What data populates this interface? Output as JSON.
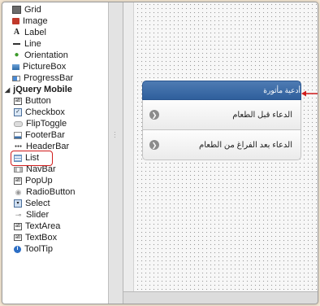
{
  "toolbox": {
    "items_top": [
      {
        "label": "Grid",
        "icon": "grid-icon"
      },
      {
        "label": "Image",
        "icon": "image-icon"
      },
      {
        "label": "Label",
        "icon": "label-icon"
      },
      {
        "label": "Line",
        "icon": "line-icon"
      },
      {
        "label": "Orientation",
        "icon": "orientation-icon"
      },
      {
        "label": "PictureBox",
        "icon": "picturebox-icon"
      },
      {
        "label": "ProgressBar",
        "icon": "progressbar-icon"
      }
    ],
    "group_label": "jQuery Mobile",
    "items_jq": [
      {
        "label": "Button",
        "icon": "button-icon"
      },
      {
        "label": "Checkbox",
        "icon": "checkbox-icon"
      },
      {
        "label": "FlipToggle",
        "icon": "fliptoggle-icon"
      },
      {
        "label": "FooterBar",
        "icon": "footerbar-icon"
      },
      {
        "label": "HeaderBar",
        "icon": "headerbar-icon"
      },
      {
        "label": "List",
        "icon": "list-icon"
      },
      {
        "label": "NavBar",
        "icon": "navbar-icon"
      },
      {
        "label": "PopUp",
        "icon": "popup-icon"
      },
      {
        "label": "RadioButton",
        "icon": "radiobutton-icon"
      },
      {
        "label": "Select",
        "icon": "select-icon"
      },
      {
        "label": "Slider",
        "icon": "slider-icon"
      },
      {
        "label": "TextArea",
        "icon": "textarea-icon"
      },
      {
        "label": "TextBox",
        "icon": "textbox-icon"
      },
      {
        "label": "ToolTip",
        "icon": "tooltip-icon"
      }
    ],
    "highlighted": "List",
    "highlight_color": "#d01c1c"
  },
  "canvas": {
    "list": {
      "divider": "أدعية مأثورة",
      "rows": [
        "الدعاء قبل الطعام",
        "الدعاء بعد الفراغ من الطعام"
      ],
      "divider_color": "#3567a6"
    }
  }
}
